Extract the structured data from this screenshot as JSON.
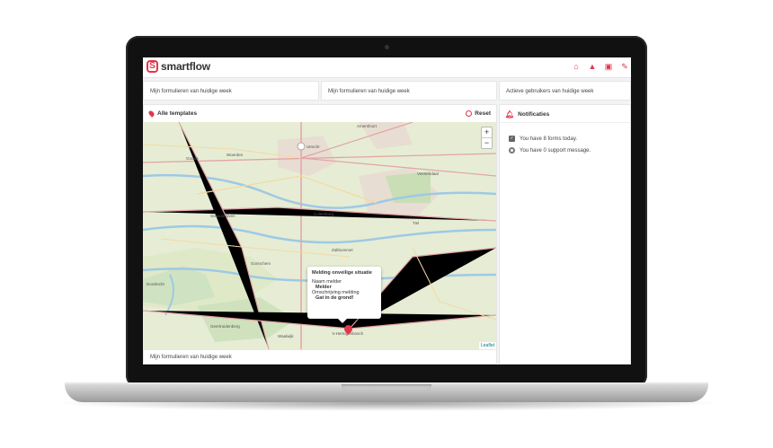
{
  "app": {
    "logo_text": "smartflow",
    "brand_color": "#e1364b"
  },
  "topbar": {
    "icons": [
      "home-icon",
      "graduation-cap-icon",
      "calendar-icon",
      "pencil-icon"
    ]
  },
  "stats": {
    "card1": "Mijn formulieren van huidige week",
    "card2": "Mijn formulieren van huidige week",
    "card3": "Actieve gebruikers van huidige week"
  },
  "map_panel": {
    "title": "Alle templates",
    "reset_label": "Reset",
    "zoom_in": "+",
    "zoom_out": "−",
    "attribution": "Leaflet",
    "places": [
      "Amersfoort",
      "Utrecht",
      "Gouda",
      "Woerden",
      "Culemborg",
      "Gorinchem",
      "Dordrecht",
      "'s-Hertogenbosch",
      "Tiel",
      "Veenendaal",
      "Schoonhoven",
      "Zaltbommel",
      "Waalwijk",
      "Geertruidenberg"
    ],
    "popup": {
      "title": "Melding onveilige situatie",
      "field1_label": "Naam melder",
      "field1_value": "Melder",
      "field2_label": "Omschrijving melding",
      "field2_value": "Gat in de grond!"
    }
  },
  "footer_card": "Mijn formulieren van huidige week",
  "notifications": {
    "title": "Notificaties",
    "items": [
      {
        "icon": "check-square-icon",
        "text": "You have 8 forms today."
      },
      {
        "icon": "lifebuoy-icon",
        "text": "You have 0 support message."
      }
    ]
  }
}
